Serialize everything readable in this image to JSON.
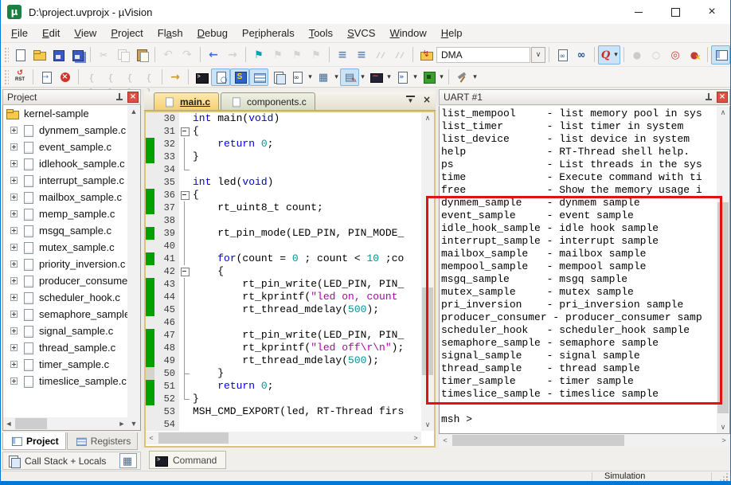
{
  "window": {
    "title": "D:\\project.uvprojx - µVision"
  },
  "menu": {
    "items": [
      {
        "pre": "",
        "u": "F",
        "post": "ile"
      },
      {
        "pre": "",
        "u": "E",
        "post": "dit"
      },
      {
        "pre": "",
        "u": "V",
        "post": "iew"
      },
      {
        "pre": "",
        "u": "P",
        "post": "roject"
      },
      {
        "pre": "Fl",
        "u": "a",
        "post": "sh"
      },
      {
        "pre": "",
        "u": "D",
        "post": "ebug"
      },
      {
        "pre": "Pe",
        "u": "r",
        "post": "ipherals"
      },
      {
        "pre": "",
        "u": "T",
        "post": "ools"
      },
      {
        "pre": "",
        "u": "S",
        "post": "VCS"
      },
      {
        "pre": "",
        "u": "W",
        "post": "indow"
      },
      {
        "pre": "",
        "u": "H",
        "post": "elp"
      }
    ]
  },
  "toolbar1": {
    "combo_value": "DMA",
    "groups": [
      [
        {
          "icon": "new-file"
        },
        {
          "icon": "open-folder"
        },
        {
          "icon": "save"
        },
        {
          "icon": "save-all"
        }
      ],
      [
        {
          "icon": "cut",
          "dis": true
        },
        {
          "icon": "copy",
          "dis": true
        },
        {
          "icon": "paste"
        }
      ],
      [
        {
          "icon": "undo",
          "dis": true
        },
        {
          "icon": "redo",
          "dis": true
        }
      ],
      [
        {
          "icon": "nav-back"
        },
        {
          "icon": "nav-forward",
          "dis": true
        }
      ],
      [
        {
          "icon": "bookmark-toggle"
        },
        {
          "icon": "bookmark-prev",
          "dis": true
        },
        {
          "icon": "bookmark-next",
          "dis": true
        },
        {
          "icon": "bookmark-clear",
          "dis": true
        }
      ],
      [
        {
          "icon": "indent"
        },
        {
          "icon": "outdent"
        },
        {
          "icon": "comment",
          "dis": true
        },
        {
          "icon": "uncomment",
          "dis": true
        }
      ],
      [
        {
          "icon": "flash-download"
        },
        {
          "combo": true
        }
      ],
      [
        {
          "icon": "find-in-files"
        },
        {
          "icon": "find-next"
        }
      ],
      [
        {
          "icon": "reference-search",
          "hl": true,
          "ddin": true
        }
      ],
      [
        {
          "icon": "bp-toggle",
          "dis": true
        },
        {
          "icon": "bp-enable",
          "dis": true
        },
        {
          "icon": "bp-disable-all"
        },
        {
          "icon": "bp-kill-all"
        }
      ],
      [
        {
          "icon": "project-window",
          "hl": true
        }
      ]
    ]
  },
  "toolbar2": {
    "groups": [
      [
        {
          "icon": "reset"
        }
      ],
      [
        {
          "icon": "show-next"
        },
        {
          "icon": "stop"
        }
      ],
      [
        {
          "icon": "step-into",
          "dis": true
        },
        {
          "icon": "step-over",
          "dis": true
        },
        {
          "icon": "step-out",
          "dis": true
        },
        {
          "icon": "run-to-cursor",
          "dis": true
        }
      ],
      [
        {
          "icon": "go"
        }
      ],
      [
        {
          "icon": "command-window"
        },
        {
          "icon": "disassembly",
          "hl": true
        },
        {
          "icon": "symbols",
          "hl": true
        },
        {
          "icon": "registers",
          "hl": true
        },
        {
          "icon": "call-stack"
        },
        {
          "icon": "watch",
          "dd": true
        },
        {
          "icon": "memory",
          "dd": true
        },
        {
          "icon": "serial",
          "hl": true,
          "dd": true
        },
        {
          "icon": "analysis",
          "dd": true
        },
        {
          "icon": "trace",
          "dd": true
        },
        {
          "icon": "system-viewer",
          "dd": true
        }
      ],
      [
        {
          "icon": "tools",
          "dd": true
        }
      ]
    ]
  },
  "project_panel": {
    "title": "Project",
    "root_label": "kernel-sample",
    "files": [
      "dynmem_sample.c",
      "event_sample.c",
      "idlehook_sample.c",
      "interrupt_sample.c",
      "mailbox_sample.c",
      "memp_sample.c",
      "msgq_sample.c",
      "mutex_sample.c",
      "priority_inversion.c",
      "producer_consumer.c",
      "scheduler_hook.c",
      "semaphore_sample.c",
      "signal_sample.c",
      "thread_sample.c",
      "timer_sample.c",
      "timeslice_sample.c"
    ],
    "tabs": [
      {
        "label": "Project",
        "icon": "project-window",
        "active": true
      },
      {
        "label": "Registers",
        "icon": "registers",
        "active": false
      }
    ]
  },
  "editor": {
    "tabs": [
      {
        "label": "main.c",
        "active": true
      },
      {
        "label": "components.c",
        "active": false
      }
    ],
    "lines": [
      {
        "n": "30",
        "bar": "",
        "fold": "",
        "parts": [
          [
            "kw",
            "int"
          ],
          [
            "pl",
            " main("
          ],
          [
            "kw",
            "void"
          ],
          [
            "pl",
            ")"
          ]
        ]
      },
      {
        "n": "31",
        "bar": "",
        "fold": "open",
        "parts": [
          [
            "pl",
            "{"
          ]
        ]
      },
      {
        "n": "32",
        "bar": "g",
        "fold": "line",
        "parts": [
          [
            "pl",
            "    "
          ],
          [
            "kw",
            "return"
          ],
          [
            "pl",
            " "
          ],
          [
            "num",
            "0"
          ],
          [
            "pl",
            ";"
          ]
        ]
      },
      {
        "n": "33",
        "bar": "g",
        "fold": "line",
        "parts": [
          [
            "pl",
            "}"
          ]
        ]
      },
      {
        "n": "34",
        "bar": "",
        "fold": "end",
        "parts": []
      },
      {
        "n": "35",
        "bar": "",
        "fold": "",
        "parts": [
          [
            "kw",
            "int"
          ],
          [
            "pl",
            " led("
          ],
          [
            "kw",
            "void"
          ],
          [
            "pl",
            ")"
          ]
        ]
      },
      {
        "n": "36",
        "bar": "g",
        "fold": "open",
        "parts": [
          [
            "pl",
            "{"
          ]
        ]
      },
      {
        "n": "37",
        "bar": "g",
        "fold": "line",
        "parts": [
          [
            "pl",
            "    rt_uint8_t count;"
          ]
        ]
      },
      {
        "n": "38",
        "bar": "",
        "fold": "line",
        "parts": []
      },
      {
        "n": "39",
        "bar": "g",
        "fold": "line",
        "parts": [
          [
            "pl",
            "    rt_pin_mode(LED_PIN, PIN_MODE_"
          ]
        ]
      },
      {
        "n": "40",
        "bar": "",
        "fold": "line",
        "parts": []
      },
      {
        "n": "41",
        "bar": "g",
        "fold": "line",
        "parts": [
          [
            "pl",
            "    "
          ],
          [
            "kw",
            "for"
          ],
          [
            "pl",
            "(count = "
          ],
          [
            "num",
            "0"
          ],
          [
            "pl",
            " ; count < "
          ],
          [
            "num",
            "10"
          ],
          [
            "pl",
            " ;co"
          ]
        ]
      },
      {
        "n": "42",
        "bar": "",
        "fold": "open",
        "parts": [
          [
            "pl",
            "    {"
          ]
        ]
      },
      {
        "n": "43",
        "bar": "g",
        "fold": "line",
        "parts": [
          [
            "pl",
            "        rt_pin_write(LED_PIN, PIN_"
          ]
        ]
      },
      {
        "n": "44",
        "bar": "g",
        "fold": "line",
        "parts": [
          [
            "pl",
            "        rt_kprintf("
          ],
          [
            "str",
            "\"led on, count"
          ]
        ]
      },
      {
        "n": "45",
        "bar": "g",
        "fold": "line",
        "parts": [
          [
            "pl",
            "        rt_thread_mdelay("
          ],
          [
            "num",
            "500"
          ],
          [
            "pl",
            ");"
          ]
        ]
      },
      {
        "n": "46",
        "bar": "",
        "fold": "line",
        "parts": []
      },
      {
        "n": "47",
        "bar": "g",
        "fold": "line",
        "parts": [
          [
            "pl",
            "        rt_pin_write(LED_PIN, PIN_"
          ]
        ]
      },
      {
        "n": "48",
        "bar": "g",
        "fold": "line",
        "parts": [
          [
            "pl",
            "        rt_kprintf("
          ],
          [
            "str",
            "\"led off\\r\\n\""
          ],
          [
            "pl",
            ");"
          ]
        ]
      },
      {
        "n": "49",
        "bar": "g",
        "fold": "line",
        "parts": [
          [
            "pl",
            "        rt_thread_mdelay("
          ],
          [
            "num",
            "500"
          ],
          [
            "pl",
            ");"
          ]
        ]
      },
      {
        "n": "50",
        "bar": "p",
        "fold": "endline",
        "parts": [
          [
            "pl",
            "    }"
          ]
        ]
      },
      {
        "n": "51",
        "bar": "g",
        "fold": "line",
        "parts": [
          [
            "pl",
            "    "
          ],
          [
            "kw",
            "return"
          ],
          [
            "pl",
            " "
          ],
          [
            "num",
            "0"
          ],
          [
            "pl",
            ";"
          ]
        ]
      },
      {
        "n": "52",
        "bar": "g",
        "fold": "end",
        "parts": [
          [
            "pl",
            "}"
          ]
        ]
      },
      {
        "n": "53",
        "bar": "",
        "fold": "",
        "parts": [
          [
            "pl",
            "MSH_CMD_EXPORT(led, RT-Thread firs"
          ]
        ]
      },
      {
        "n": "54",
        "bar": "",
        "fold": "",
        "parts": []
      }
    ]
  },
  "uart": {
    "title": "UART #1",
    "lines": [
      "list_mempool     - list memory pool in sys",
      "list_timer       - list timer in system",
      "list_device      - list device in system",
      "help             - RT-Thread shell help.",
      "ps               - List threads in the sys",
      "time             - Execute command with ti",
      "free             - Show the memory usage i",
      "dynmem_sample    - dynmem sample",
      "event_sample     - event sample",
      "idle_hook_sample - idle hook sample",
      "interrupt_sample - interrupt sample",
      "mailbox_sample   - mailbox sample",
      "mempool_sample   - mempool sample",
      "msgq_sample      - msgq sample",
      "mutex_sample     - mutex sample",
      "pri_inversion    - pri_inversion sample",
      "producer_consumer - producer_consumer samp",
      "scheduler_hook   - scheduler_hook sample",
      "semaphore_sample - semaphore sample",
      "signal_sample    - signal sample",
      "thread_sample    - thread sample",
      "timer_sample     - timer sample",
      "timeslice_sample - timeslice sample",
      "",
      "msh >"
    ]
  },
  "panels": {
    "callstack_label": "Call Stack + Locals",
    "command_label": "Command"
  },
  "statusbar": {
    "mode": "Simulation"
  }
}
